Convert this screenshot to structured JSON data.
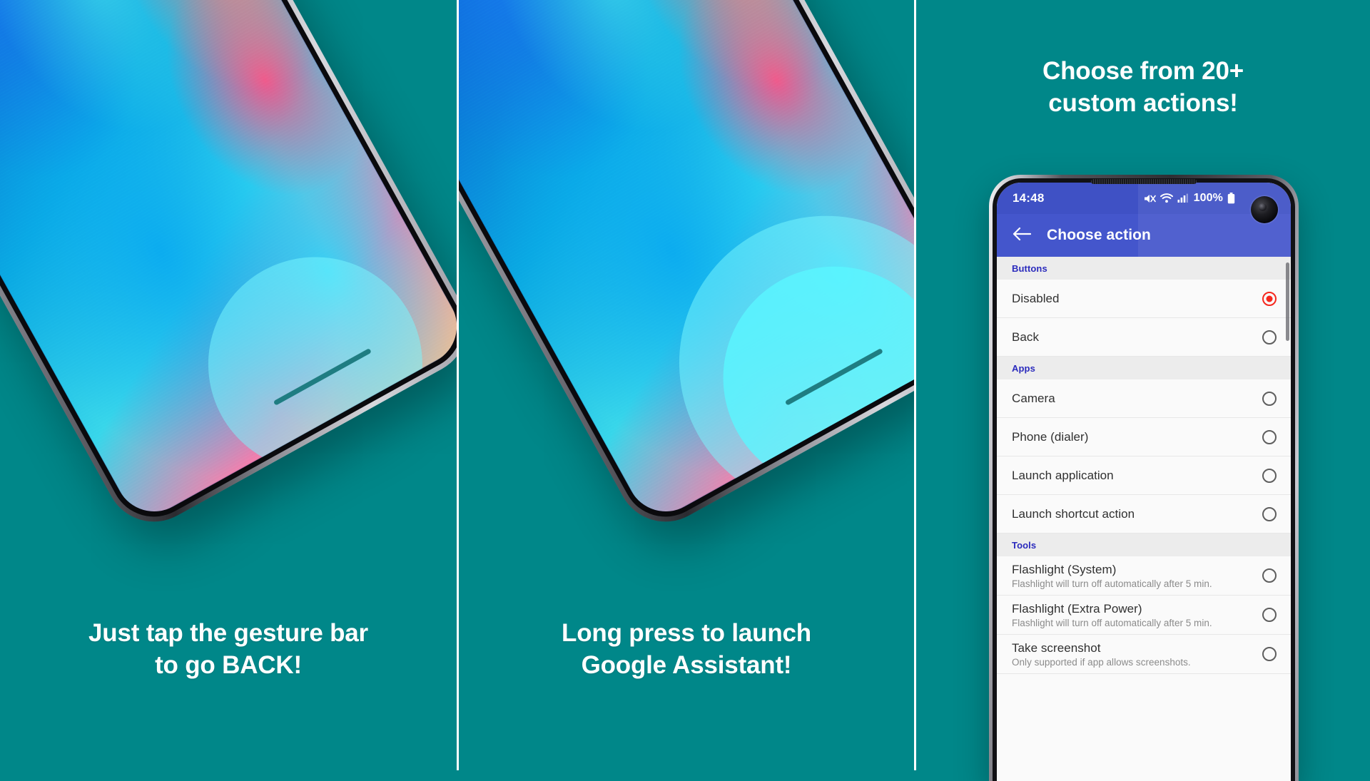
{
  "theme": {
    "background_teal": "#008789",
    "divider_white": "#ffffff",
    "status_bar_purple": "#3f51c5",
    "app_bar_purple": "#4456cc",
    "section_header_text": "#2b2bbd",
    "selected_radio_red": "#f5281e",
    "list_background": "#fafafa",
    "section_header_background": "#ececec"
  },
  "panels": [
    {
      "id": "panel-1",
      "caption_lines": [
        "Just tap the gesture bar",
        "to go BACK!"
      ],
      "gesture_ripple": "single"
    },
    {
      "id": "panel-2",
      "caption_lines": [
        "Long press to launch",
        "Google Assistant!"
      ],
      "gesture_ripple": "double"
    }
  ],
  "panel3": {
    "headline_lines": [
      "Choose from 20+",
      "custom actions!"
    ],
    "status_bar": {
      "time": "14:48",
      "battery_percent": "100%",
      "icons": [
        "mute-icon",
        "wifi-icon",
        "signal-icon",
        "battery-icon"
      ]
    },
    "app_bar": {
      "back_icon": "back-arrow-icon",
      "title": "Choose action"
    },
    "sections": [
      {
        "header": "Buttons",
        "rows": [
          {
            "title": "Disabled",
            "subtitle": "",
            "selected": true
          },
          {
            "title": "Back",
            "subtitle": "",
            "selected": false
          }
        ]
      },
      {
        "header": "Apps",
        "rows": [
          {
            "title": "Camera",
            "subtitle": "",
            "selected": false
          },
          {
            "title": "Phone (dialer)",
            "subtitle": "",
            "selected": false
          },
          {
            "title": "Launch application",
            "subtitle": "",
            "selected": false
          },
          {
            "title": "Launch shortcut action",
            "subtitle": "",
            "selected": false
          }
        ]
      },
      {
        "header": "Tools",
        "rows": [
          {
            "title": "Flashlight (System)",
            "subtitle": "Flashlight will turn off automatically after 5 min.",
            "selected": false
          },
          {
            "title": "Flashlight (Extra Power)",
            "subtitle": "Flashlight will turn off automatically after 5 min.",
            "selected": false
          },
          {
            "title": "Take screenshot",
            "subtitle": "Only supported if app allows screenshots.",
            "selected": false
          }
        ]
      }
    ]
  }
}
